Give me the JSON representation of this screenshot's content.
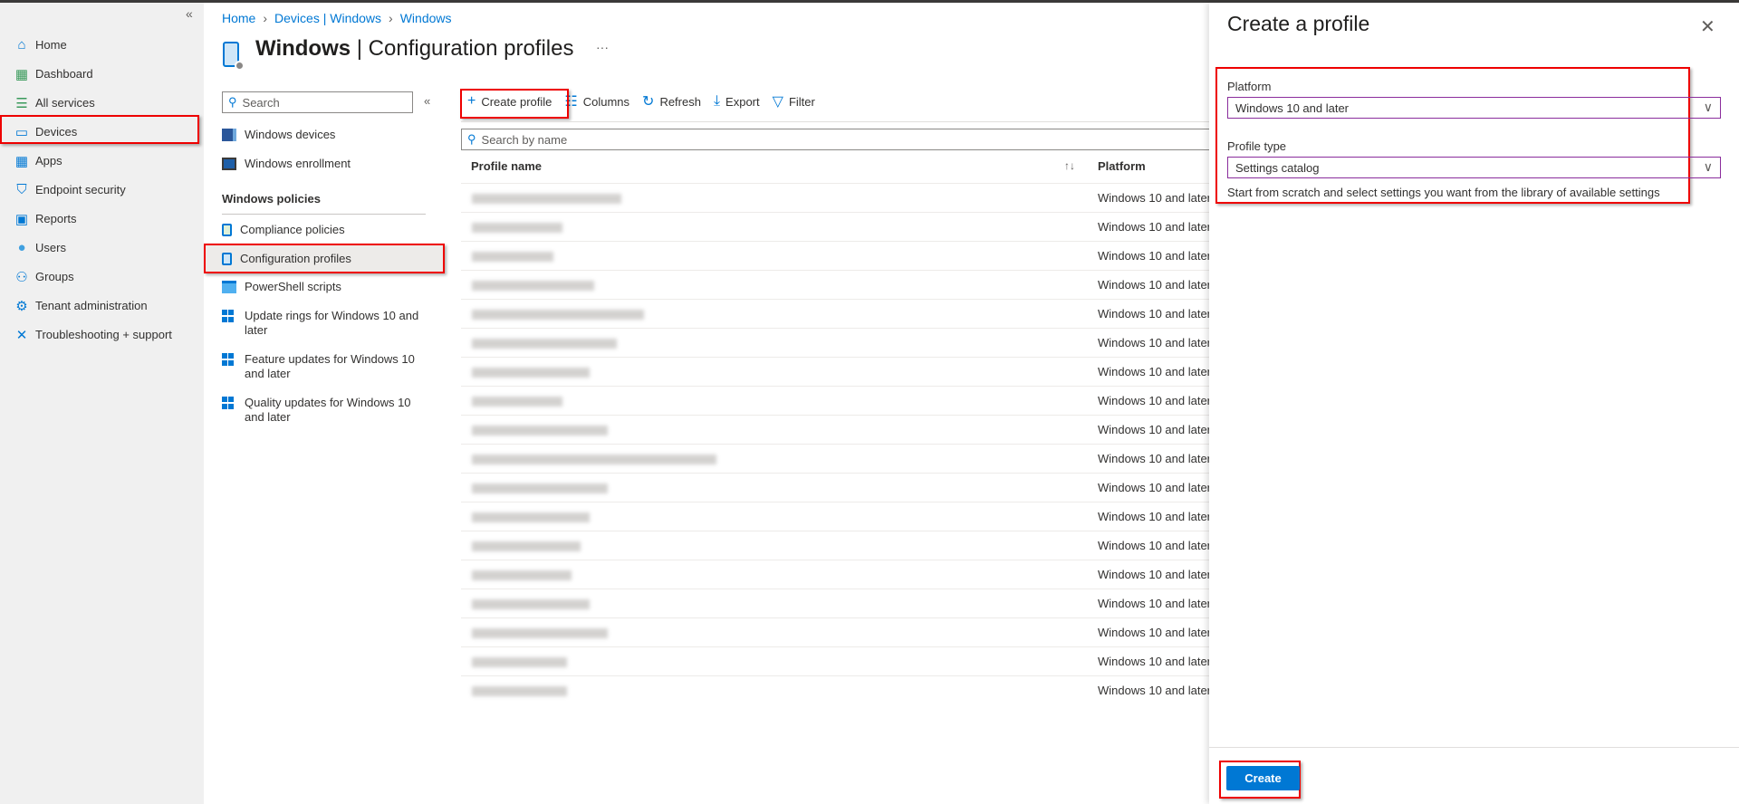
{
  "left_nav": {
    "collapse": "«",
    "items": [
      {
        "label": "Home",
        "icon": "home-icon"
      },
      {
        "label": "Dashboard",
        "icon": "dashboard-icon"
      },
      {
        "label": "All services",
        "icon": "list-icon"
      },
      {
        "label": "Devices",
        "icon": "devices-icon",
        "selected": true
      },
      {
        "label": "Apps",
        "icon": "apps-icon"
      },
      {
        "label": "Endpoint security",
        "icon": "shield-icon"
      },
      {
        "label": "Reports",
        "icon": "reports-icon"
      },
      {
        "label": "Users",
        "icon": "user-icon"
      },
      {
        "label": "Groups",
        "icon": "groups-icon"
      },
      {
        "label": "Tenant administration",
        "icon": "tenant-admin-icon"
      },
      {
        "label": "Troubleshooting + support",
        "icon": "wrench-icon"
      }
    ]
  },
  "breadcrumb": [
    "Home",
    "Devices | Windows",
    "Windows"
  ],
  "page": {
    "title_bold": "Windows",
    "title_rest": " | Configuration profiles",
    "more": "···"
  },
  "subnav": {
    "search_placeholder": "Search",
    "collapse": "«",
    "items_top": [
      {
        "label": "Windows devices"
      },
      {
        "label": "Windows enrollment"
      }
    ],
    "section": "Windows policies",
    "items": [
      {
        "label": "Compliance policies"
      },
      {
        "label": "Configuration profiles",
        "selected": true
      },
      {
        "label": "PowerShell scripts"
      },
      {
        "label": "Update rings for Windows 10 and later"
      },
      {
        "label": "Feature updates for Windows 10 and later"
      },
      {
        "label": "Quality updates for Windows 10 and later"
      }
    ]
  },
  "toolbar": {
    "create": "Create profile",
    "columns": "Columns",
    "refresh": "Refresh",
    "export": "Export",
    "filter": "Filter"
  },
  "table": {
    "search_placeholder": "Search by name",
    "columns": [
      "Profile name",
      "Platform"
    ],
    "sort_icon": "↑↓",
    "rows_platform": [
      "Windows 10 and later",
      "Windows 10 and later",
      "Windows 10 and later",
      "Windows 10 and later",
      "Windows 10 and later",
      "Windows 10 and later",
      "Windows 10 and later",
      "Windows 10 and later",
      "Windows 10 and later",
      "Windows 10 and later",
      "Windows 10 and later",
      "Windows 10 and later",
      "Windows 10 and later",
      "Windows 10 and later",
      "Windows 10 and later",
      "Windows 10 and later",
      "Windows 10 and later",
      "Windows 10 and later"
    ]
  },
  "panel": {
    "title": "Create a profile",
    "platform_label": "Platform",
    "platform_value": "Windows 10 and later",
    "profile_type_label": "Profile type",
    "profile_type_value": "Settings catalog",
    "description": "Start from scratch and select settings you want from the library of available settings",
    "create_button": "Create"
  },
  "colors": {
    "accent": "#0078d4",
    "highlight": "#e00000",
    "dropdown_border": "#8a2d9c"
  }
}
